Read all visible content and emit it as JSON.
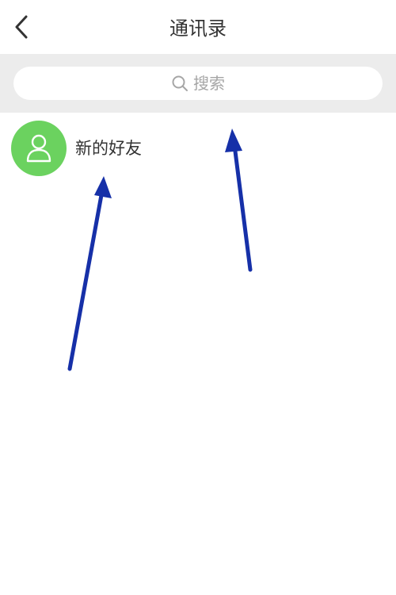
{
  "header": {
    "title": "通讯录",
    "back_icon": "chevron-left-icon"
  },
  "search": {
    "placeholder": "搜索",
    "icon": "search-icon"
  },
  "contacts": {
    "items": [
      {
        "label": "新的好友",
        "icon": "person-icon",
        "color": "#6bd25f"
      }
    ]
  },
  "colors": {
    "search_band": "#ececec",
    "avatar_green": "#6bd25f",
    "annotation_arrow": "#1630a8"
  }
}
